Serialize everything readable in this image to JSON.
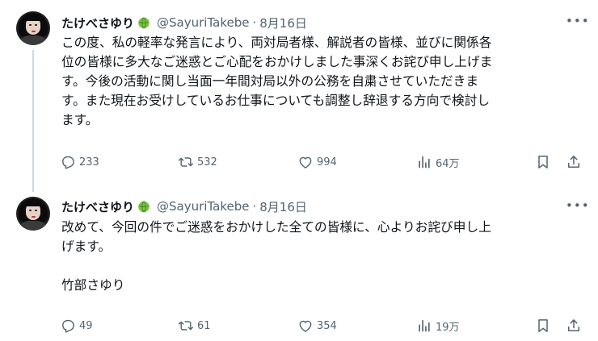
{
  "tweets": [
    {
      "author": {
        "name": "たけべさゆり",
        "handle": "@SayuriTakebe",
        "date": "8月16日"
      },
      "more_label": "•••",
      "lines": [
        "この度、私の軽率な発言により、両対局者様、解説者の皆様、並びに関係各",
        "位の皆様に多大なご迷惑とご心配をおかけしました事深くお詫び申し上げま",
        "す。今後の活動に関し当面一年間対局以外の公務を自粛させていただきま",
        "す。また現在お受けしているお仕事についても調整し辞退する方向で検討し",
        "ます。"
      ],
      "stats": {
        "replies": "233",
        "retweets": "532",
        "likes": "994",
        "views": "64万"
      }
    },
    {
      "author": {
        "name": "たけべさゆり",
        "handle": "@SayuriTakebe",
        "date": "8月16日"
      },
      "more_label": "•••",
      "lines": [
        "改めて、今回の件でご迷惑をおかけした全ての皆様に、心よりお詫び申し上",
        "げます。",
        "",
        "竹部さゆり"
      ],
      "stats": {
        "replies": "49",
        "retweets": "61",
        "likes": "354",
        "views": "19万"
      }
    }
  ],
  "header_separator": "·",
  "icons": {
    "reply": "reply-icon",
    "retweet": "retweet-icon",
    "like": "heart-icon",
    "views": "views-icon",
    "bookmark": "bookmark-icon",
    "share": "share-icon",
    "badge": "melon-icon"
  },
  "colors": {
    "text": "#0f1419",
    "secondary": "#536471",
    "thread_line": "#cfd9de",
    "badge": "#6fbf3a"
  }
}
